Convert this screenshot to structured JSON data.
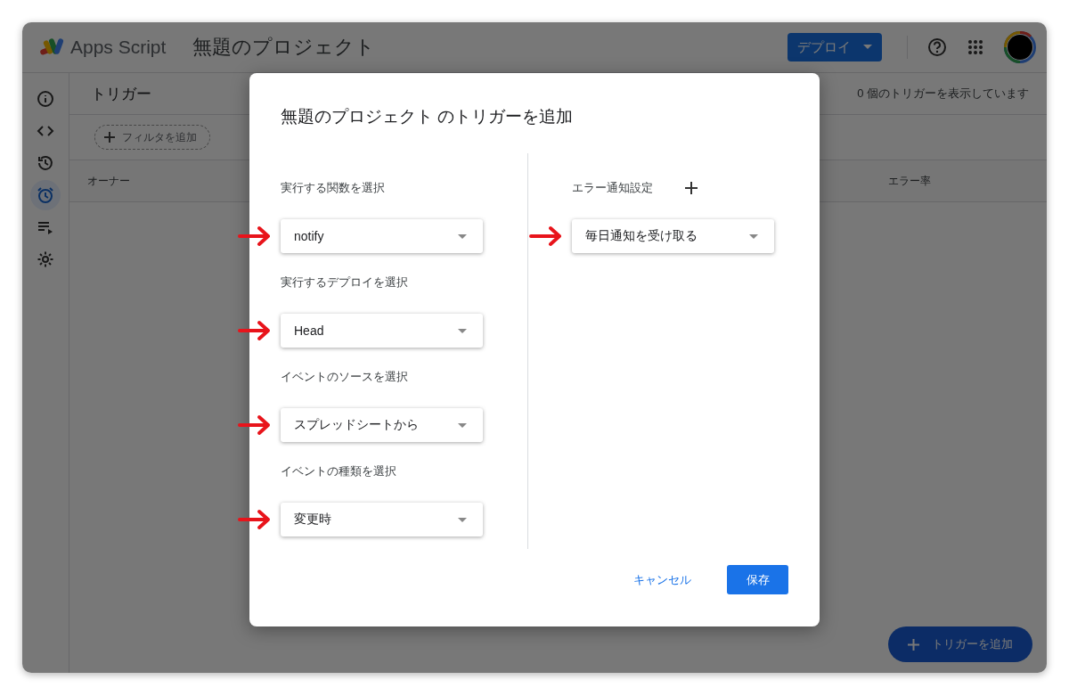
{
  "app": {
    "logo_text": "Apps Script",
    "project_title": "無題のプロジェクト",
    "deploy_button": "デプロイ"
  },
  "sidebar": {
    "items": [
      {
        "kind": "info",
        "selected": false
      },
      {
        "kind": "code",
        "selected": false
      },
      {
        "kind": "history",
        "selected": false
      },
      {
        "kind": "alarm",
        "selected": true
      },
      {
        "kind": "executions",
        "selected": false
      },
      {
        "kind": "settings",
        "selected": false
      }
    ]
  },
  "page": {
    "title": "トリガー",
    "count_text": "0 個のトリガーを表示しています",
    "filter_button": "フィルタを追加",
    "columns": [
      "オーナー",
      "エラー率"
    ],
    "fab": "トリガーを追加"
  },
  "dialog": {
    "title": "無題のプロジェクト のトリガーを追加",
    "fields": [
      {
        "label": "実行する関数を選択",
        "value": "notify",
        "annotated": true
      },
      {
        "label": "実行するデプロイを選択",
        "value": "Head",
        "annotated": true
      },
      {
        "label": "イベントのソースを選択",
        "value": "スプレッドシートから",
        "annotated": true
      },
      {
        "label": "イベントの種類を選択",
        "value": "変更時",
        "annotated": true
      }
    ],
    "error_setting": {
      "label": "エラー通知設定",
      "value": "毎日通知を受け取る",
      "annotated": true
    },
    "buttons": [
      {
        "label": "キャンセル",
        "kind": "text"
      },
      {
        "label": "保存",
        "kind": "primary"
      }
    ]
  }
}
